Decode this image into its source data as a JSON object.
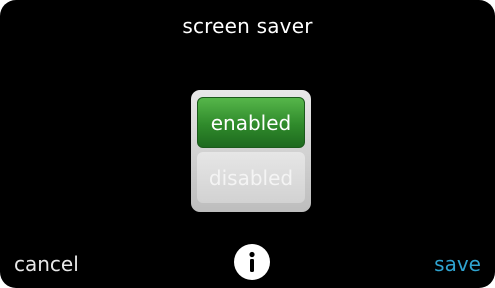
{
  "header": {
    "title": "screen saver"
  },
  "options": {
    "enabled_label": "enabled",
    "disabled_label": "disabled",
    "selected": "enabled"
  },
  "footer": {
    "cancel_label": "cancel",
    "save_label": "save",
    "info_icon": "info-icon"
  },
  "colors": {
    "background": "#000000",
    "selected_option": "#2f8a2b",
    "save_accent": "#2fa3cf"
  }
}
